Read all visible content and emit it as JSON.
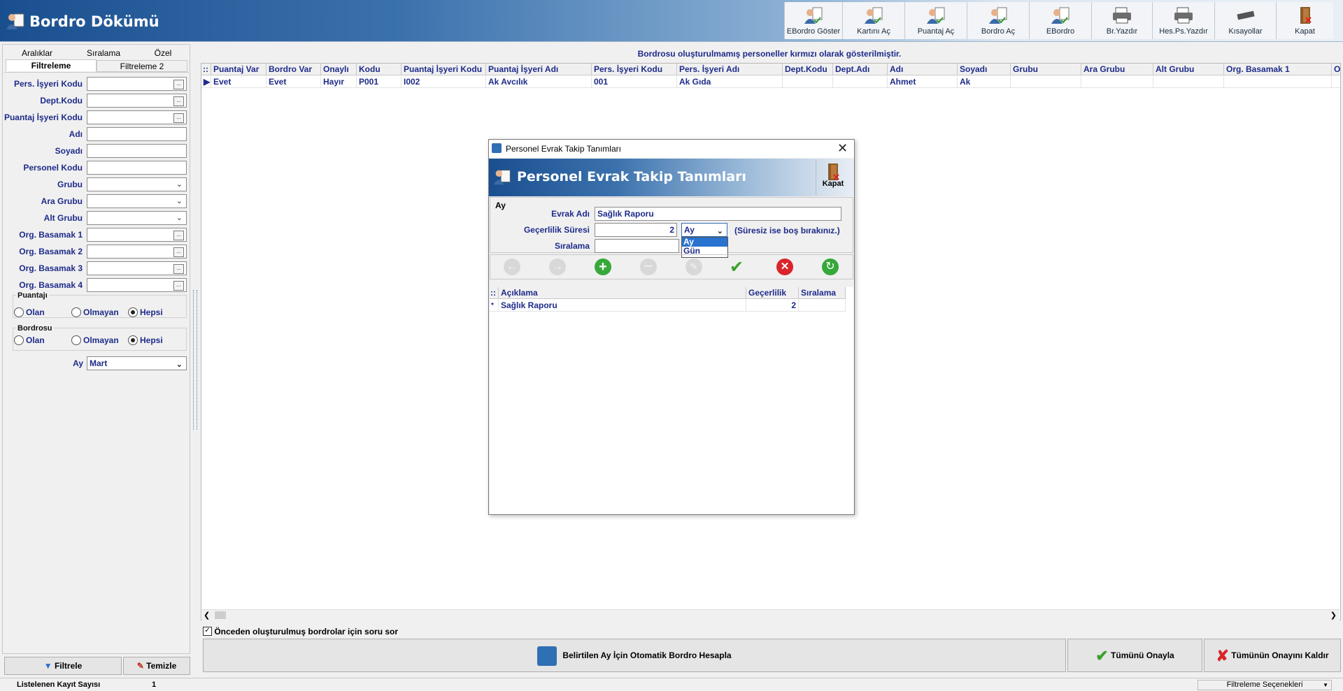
{
  "app": {
    "title": "Bordro Dökümü"
  },
  "toolbar": [
    {
      "label": "EBordro Göster",
      "icon": "people-document-icon"
    },
    {
      "label": "Kartını Aç",
      "icon": "people-check-icon"
    },
    {
      "label": "Puantaj Aç",
      "icon": "people-chart-icon"
    },
    {
      "label": "Bordro Aç",
      "icon": "people-icon"
    },
    {
      "label": "EBordro",
      "icon": "people-doc-icon"
    },
    {
      "label": "Br.Yazdır",
      "icon": "printer-icon"
    },
    {
      "label": "Hes.Ps.Yazdır",
      "icon": "printer-icon"
    },
    {
      "label": "Kısayollar",
      "icon": "keyboard-icon"
    },
    {
      "label": "Kapat",
      "icon": "exit-door-icon"
    }
  ],
  "left": {
    "tabs_row1": [
      "Aralıklar",
      "Sıralama",
      "Özel"
    ],
    "tabs_row2": [
      "Filtreleme",
      "Filtreleme 2"
    ],
    "fields": [
      {
        "label": "Pers. İşyeri Kodu",
        "type": "lookup"
      },
      {
        "label": "Dept.Kodu",
        "type": "lookup"
      },
      {
        "label": "Puantaj İşyeri Kodu",
        "type": "lookup"
      },
      {
        "label": "Adı",
        "type": "text"
      },
      {
        "label": "Soyadı",
        "type": "text"
      },
      {
        "label": "Personel Kodu",
        "type": "text"
      },
      {
        "label": "Grubu",
        "type": "combo"
      },
      {
        "label": "Ara Grubu",
        "type": "combo"
      },
      {
        "label": "Alt Grubu",
        "type": "combo"
      },
      {
        "label": "Org. Basamak 1",
        "type": "lookup"
      },
      {
        "label": "Org. Basamak 2",
        "type": "lookup"
      },
      {
        "label": "Org. Basamak 3",
        "type": "lookup"
      },
      {
        "label": "Org. Basamak 4",
        "type": "lookup"
      }
    ],
    "puantaj": {
      "title": "Puantajı",
      "options": [
        "Olan",
        "Olmayan",
        "Hepsi"
      ],
      "selected": "Hepsi"
    },
    "bordro": {
      "title": "Bordrosu",
      "options": [
        "Olan",
        "Olmayan",
        "Hepsi"
      ],
      "selected": "Hepsi"
    },
    "ay": {
      "label": "Ay",
      "value": "Mart"
    },
    "filter_button": "Filtrele",
    "clear_button": "Temizle"
  },
  "main": {
    "notice": "Bordrosu oluşturulmamış personeller kırmızı olarak gösterilmiştir.",
    "columns": [
      "Puantaj Var",
      "Bordro Var",
      "Onaylı",
      "Kodu",
      "Puantaj İşyeri Kodu",
      "Puantaj İşyeri Adı",
      "Pers. İşyeri Kodu",
      "Pers. İşyeri Adı",
      "Dept.Kodu",
      "Dept.Adı",
      "Adı",
      "Soyadı",
      "Grubu",
      "Ara Grubu",
      "Alt Grubu",
      "Org. Basamak 1",
      "Org"
    ],
    "rows": [
      [
        "Evet",
        "Evet",
        "Hayır",
        "P001",
        "I002",
        "Ak Avcılık",
        "001",
        "Ak Gıda",
        "",
        "",
        "Ahmet",
        "Ak",
        "",
        "",
        "",
        "",
        ""
      ]
    ],
    "ask_checkbox": "Önceden oluşturulmuş bordrolar için soru sor",
    "ask_checked": true,
    "auto_button": "Belirtilen Ay İçin Otomatik Bordro Hesapla",
    "approve_all": "Tümünü Onayla",
    "unapprove_all": "Tümünün Onayını Kaldır"
  },
  "status": {
    "count_label": "Listelenen Kayıt Sayısı",
    "count": "1",
    "filter_options": "Filtreleme Seçenekleri"
  },
  "dialog": {
    "window_title": "Personel Evrak Takip Tanımları",
    "banner_title": "Personel Evrak Takip Tanımları",
    "close_label": "Kapat",
    "section_caption": "Ay",
    "evrak_label": "Evrak Adı",
    "evrak_value": "Sağlık Raporu",
    "gecerlilik_label": "Geçerlilik Süresi",
    "gecerlilik_value": "2",
    "unit_value": "Ay",
    "unit_options": [
      "Ay",
      "Gün"
    ],
    "unit_hint": "(Süresiz ise boş bırakınız.)",
    "siralama_label": "Sıralama",
    "siralama_value": "",
    "grid_columns": [
      "Açıklama",
      "Geçerlilik",
      "Sıralama"
    ],
    "grid_rows": [
      [
        "Sağlık Raporu",
        "2",
        ""
      ]
    ]
  }
}
